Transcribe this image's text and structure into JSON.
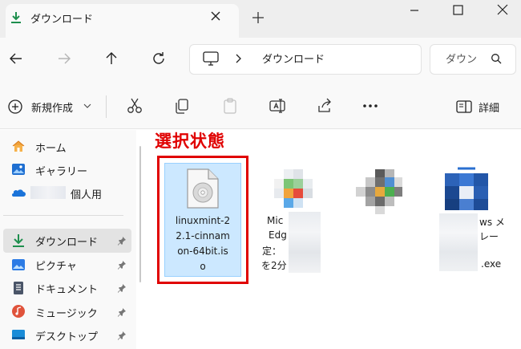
{
  "tab": {
    "title": "ダウンロード"
  },
  "breadcrumb": {
    "location": "ダウンロード"
  },
  "search": {
    "placeholder_text": "ダウン"
  },
  "toolbar": {
    "new_label": "新規作成",
    "details_label": "詳細"
  },
  "sidebar": {
    "items": [
      {
        "label": "ホーム",
        "icon": "home-icon"
      },
      {
        "label": "ギャラリー",
        "icon": "gallery-icon"
      },
      {
        "label": "個人用",
        "icon": "onedrive-icon"
      },
      {
        "label": "ダウンロード",
        "icon": "download-icon",
        "selected": true,
        "pinned": true
      },
      {
        "label": "ピクチャ",
        "icon": "pictures-icon",
        "pinned": true
      },
      {
        "label": "ドキュメント",
        "icon": "documents-icon",
        "pinned": true
      },
      {
        "label": "ミュージック",
        "icon": "music-icon",
        "pinned": true
      },
      {
        "label": "デスクトップ",
        "icon": "desktop-icon",
        "pinned": true
      }
    ]
  },
  "annotation": {
    "text": "選択状態",
    "color": "#e00000"
  },
  "files": [
    {
      "name": "linuxmint-22.1-cinnamon-64bit.iso",
      "lines": [
        "linuxmint-2",
        "2.1-cinnam",
        "on-64bit.is",
        "o"
      ],
      "selected": true
    },
    {
      "name_visible_fragments": [
        "Mic",
        "Edg",
        "定：",
        "を2分"
      ]
    },
    {
      "name_visible_fragments": []
    },
    {
      "name_visible_fragments": [
        "ws メ",
        "レー",
        ".exe"
      ]
    }
  ],
  "colors": {
    "accent": "#005fb8",
    "selection": "#cce8ff",
    "selection_border": "#99d1ff",
    "download_green": "#1e8f4e"
  }
}
